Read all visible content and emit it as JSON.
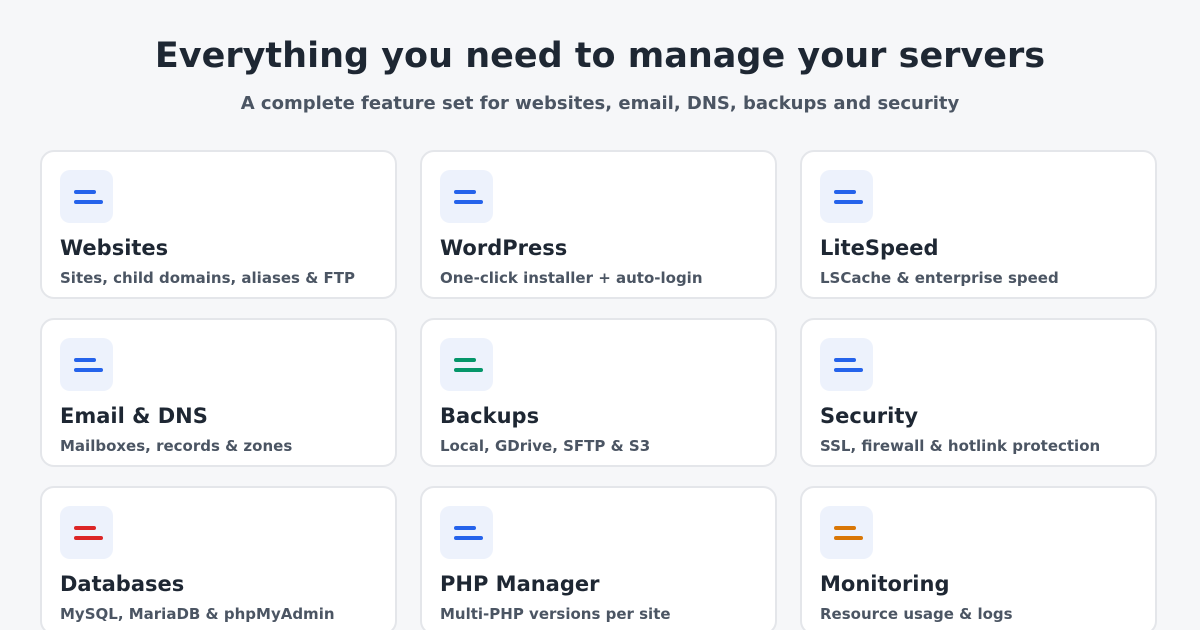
{
  "header": {
    "title": "Everything you need to manage your servers",
    "subtitle": "A complete feature set for websites, email, DNS, backups and security"
  },
  "cards": [
    {
      "title": "Websites",
      "description": "Sites, child domains, aliases & FTP",
      "icon": "menu-lines-icon",
      "icon_color": "#2563eb"
    },
    {
      "title": "WordPress",
      "description": "One-click installer + auto-login",
      "icon": "menu-lines-icon",
      "icon_color": "#2563eb"
    },
    {
      "title": "LiteSpeed",
      "description": "LSCache & enterprise speed",
      "icon": "menu-lines-icon",
      "icon_color": "#2563eb"
    },
    {
      "title": "Email & DNS",
      "description": "Mailboxes, records & zones",
      "icon": "menu-lines-icon",
      "icon_color": "#2563eb"
    },
    {
      "title": "Backups",
      "description": "Local, GDrive, SFTP & S3",
      "icon": "menu-lines-icon",
      "icon_color": "#059669"
    },
    {
      "title": "Security",
      "description": "SSL, firewall & hotlink protection",
      "icon": "menu-lines-icon",
      "icon_color": "#2563eb"
    },
    {
      "title": "Databases",
      "description": "MySQL, MariaDB & phpMyAdmin",
      "icon": "menu-lines-icon",
      "icon_color": "#dc2626"
    },
    {
      "title": "PHP Manager",
      "description": "Multi-PHP versions per site",
      "icon": "menu-lines-icon",
      "icon_color": "#2563eb"
    },
    {
      "title": "Monitoring",
      "description": "Resource usage & logs",
      "icon": "menu-lines-icon",
      "icon_color": "#d97706"
    }
  ]
}
